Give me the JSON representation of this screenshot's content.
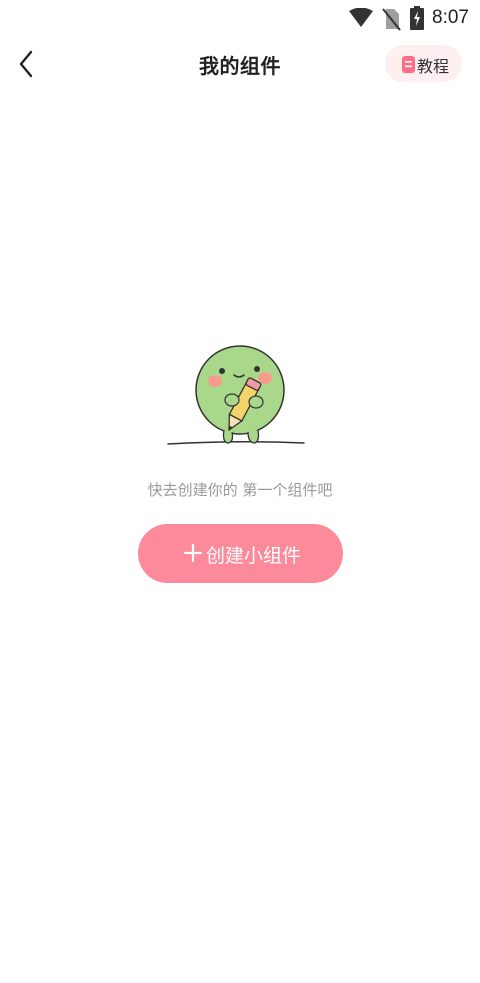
{
  "status_bar": {
    "time": "8:07",
    "icons": [
      "wifi-icon",
      "no-sim-icon",
      "battery-charging-icon"
    ]
  },
  "header": {
    "title": "我的组件",
    "back_icon": "chevron-left-icon",
    "tutorial_label": "教程",
    "tutorial_icon": "document-icon"
  },
  "empty_state": {
    "illustration": "mascot-with-pencil",
    "message": "快去创建你的 第一个组件吧",
    "create_label": "创建小组件",
    "create_icon": "plus-icon"
  },
  "colors": {
    "accent": "#fd8a9a",
    "tutorial_bg": "#fdeef0",
    "mascot_green": "#a9d88a"
  }
}
